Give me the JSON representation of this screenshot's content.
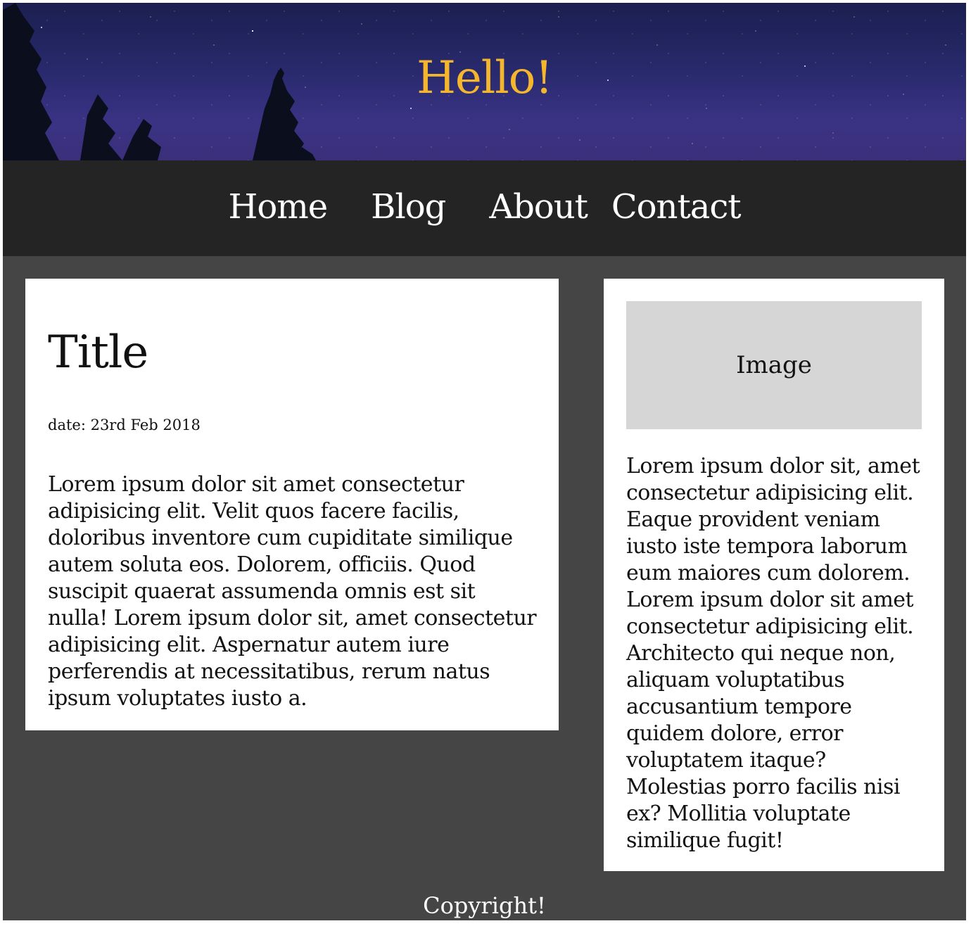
{
  "header": {
    "title": "Hello!"
  },
  "nav": {
    "items": [
      {
        "label": "Home"
      },
      {
        "label": "Blog"
      },
      {
        "label": "About"
      },
      {
        "label": "Contact"
      }
    ]
  },
  "post": {
    "title": "Title",
    "date": "date: 23rd Feb 2018",
    "body": "Lorem ipsum dolor sit amet consectetur adipisicing elit. Velit quos facere facilis, doloribus inventore cum cupiditate similique autem soluta eos. Dolorem, officiis. Quod suscipit quaerat assumenda omnis est sit nulla! Lorem ipsum dolor sit, amet consectetur adipisicing elit. Aspernatur autem iure perferendis at necessitatibus, rerum natus ipsum voluptates iusto a."
  },
  "sidebar": {
    "image_label": "Image",
    "body": "Lorem ipsum dolor sit, amet consectetur adipisicing elit. Eaque provident veniam iusto iste tempora laborum eum maiores cum dolorem. Lorem ipsum dolor sit amet consectetur adipisicing elit. Architecto qui neque non, aliquam voluptatibus accusantium tempore quidem dolore, error voluptatem itaque? Molestias porro facilis nisi ex? Mollitia voluptate similique fugit!"
  },
  "footer": {
    "text": "Copyright!"
  },
  "colors": {
    "page_background": "#454545",
    "nav_background": "#242424",
    "header_title": "#f4b62c",
    "card_background": "#ffffff",
    "image_placeholder": "#d6d6d6"
  }
}
